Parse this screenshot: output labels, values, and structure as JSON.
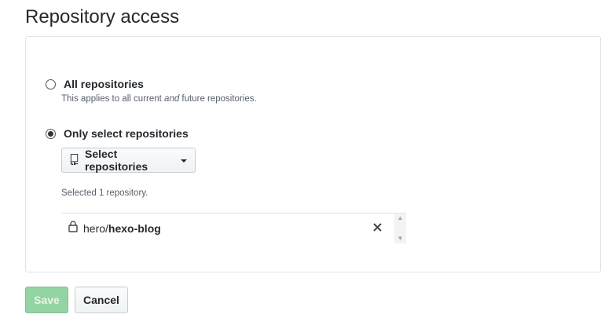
{
  "page": {
    "title": "Repository access"
  },
  "access_options": {
    "all": {
      "label": "All repositories",
      "description_prefix": "This applies to all current ",
      "description_emphasis": "and",
      "description_suffix": " future repositories.",
      "selected": false
    },
    "select": {
      "label": "Only select repositories",
      "selected": true
    }
  },
  "select_button": {
    "label": "Select repositories",
    "icon": "repo-icon"
  },
  "selection_summary": "Selected 1 repository.",
  "selected_repos": [
    {
      "owner": "hero/",
      "name": "hexo-blog",
      "icon": "lock-icon",
      "remove_glyph": "✕"
    }
  ],
  "scrollbar": {
    "up_glyph": "▲",
    "down_glyph": "▼"
  },
  "actions": {
    "save_label": "Save",
    "save_disabled": true,
    "cancel_label": "Cancel"
  },
  "colors": {
    "save_disabled_bg": "#94d3a2",
    "text_primary": "#24292e",
    "text_muted": "#586069",
    "border": "#e1e4e8"
  }
}
